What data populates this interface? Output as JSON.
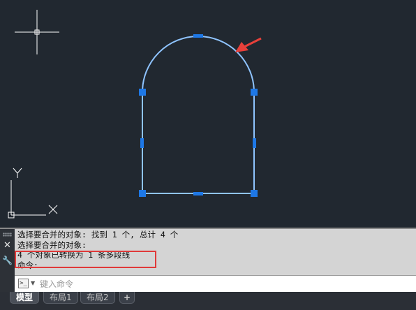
{
  "canvas": {
    "background": "#212830",
    "shape_color": "#8fc4ff",
    "grip_color": "#1e78e6",
    "arrow_color": "#e8403a",
    "ucs": {
      "y_label": "Y",
      "x_label": "X"
    }
  },
  "command_line": {
    "history": [
      "选择要合并的对象: 找到 1 个, 总计 4 个",
      "选择要合并的对象:",
      "4 个对象已转换为 1 条多段线",
      "命令:"
    ],
    "input_placeholder": "键入命令",
    "prompt_symbol": ">_",
    "highlight_color": "#e03a3a",
    "icons": [
      "close-icon",
      "wrench-icon",
      "command-prompt-icon",
      "dropdown-icon"
    ]
  },
  "tabs": {
    "items": [
      "模型",
      "布局1",
      "布局2"
    ],
    "active": "模型",
    "add_label": "+"
  }
}
